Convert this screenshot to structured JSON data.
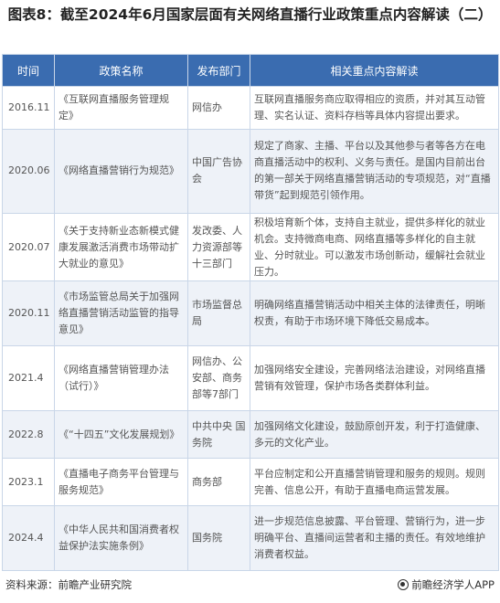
{
  "title": "图表8：截至2024年6月国家层面有关网络直播行业政策重点内容解读（二）",
  "headers": [
    "时间",
    "政策名称",
    "发布部门",
    "相关重点内容解读"
  ],
  "rows": [
    {
      "date": "2016.11",
      "name": "《互联网直播服务管理规定》",
      "org": "网信办",
      "desc": "互联网直播服务商应取得相应的资质，并对其互动管理、实名认证、资料存档等具体内容提出要求。"
    },
    {
      "date": "2020.06",
      "name": "《网络直播营销行为规范》",
      "org": "中国广告协会",
      "desc": "规定了商家、主播、平台以及其他参与者等各方在电商直播活动中的权利、义务与责任。是国内目前出台的第一部关于网络直播营销活动的专项规范，对“直播带货”起到规范引领作用。"
    },
    {
      "date": "2020.07",
      "name": "《关于支持新业态新模式健康发展激活消费市场带动扩大就业的意见》",
      "org": "发改委、人力资源部等十三部门",
      "desc": "积极培育新个体，支持自主就业，提供多样化的就业机会。支持微商电商、网络直播等多样化的自主就业、分时就业。可以激发市场创新动，缓解社会就业压力。"
    },
    {
      "date": "2020.11",
      "name": "《市场监管总局关于加强网络直播营销活动监管的指导意见》",
      "org": "市场监督总局",
      "desc": "明确网络直播营销活动中相关主体的法律责任，明晰权责，有助于市场环境下降低交易成本。"
    },
    {
      "date": "2021.4",
      "name": "《网络直播营销管理办法（试行）》",
      "org": "网信办、公安部、商务部等7部门",
      "desc": "加强网络安全建设，完善网络法治建设，对网络直播营销有效管理，保护市场各类群体利益。"
    },
    {
      "date": "2022.8",
      "name": "《“十四五”文化发展规划》",
      "org": "中共中央 国务院",
      "desc": "加强网络文化建设，鼓励原创开发，利于打造健康、多元的文化产业。"
    },
    {
      "date": "2023.1",
      "name": "《直播电子商务平台管理与服务规范》",
      "org": "商务部",
      "desc": "平台应制定和公开直播营销管理和服务的规则。规则完善、信息公开，有助于直播电商运营发展。"
    },
    {
      "date": "2024.4",
      "name": "《中华人民共和国消费者权益保护法实施条例》",
      "org": "国务院",
      "desc": "进一步规范信息披露、平台管理、营销行为，进一步明确平台、直播间运营者和主播的责任。有效地维护消费者权益。"
    }
  ],
  "footer": {
    "source": "资料来源：前瞻产业研究院",
    "brand": "前瞻经济学人APP",
    "brand_icon": "qianzhan-logo-icon"
  },
  "watermark": "前瞻产业研究院",
  "colors": {
    "header_bg": "#3a6cb0",
    "stripe": "#eef2f8",
    "border": "#c9d6e8"
  }
}
